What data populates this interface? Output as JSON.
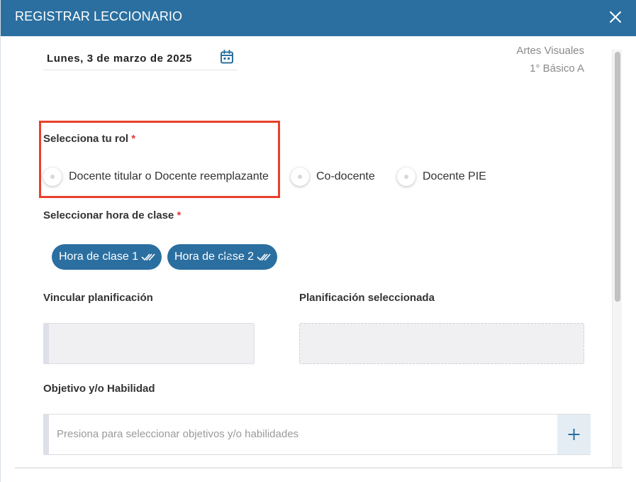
{
  "header": {
    "title": "REGISTRAR LECCIONARIO",
    "close_icon": "close-icon"
  },
  "date": {
    "value": "Lunes, 3 de marzo de 2025",
    "icon": "calendar-icon"
  },
  "subject": {
    "name": "Artes Visuales",
    "grade": "1° Básico A"
  },
  "rol": {
    "label": "Selecciona tu rol",
    "required_mark": "*",
    "options": [
      {
        "label": "Docente titular o Docente reemplazante",
        "selected": false
      },
      {
        "label": "Co-docente",
        "selected": false
      },
      {
        "label": "Docente PIE",
        "selected": false
      }
    ]
  },
  "hora": {
    "label": "Seleccionar hora de clase",
    "required_mark": "*",
    "chips": [
      {
        "label": "Hora de clase 1",
        "icon": "double-check-icon"
      },
      {
        "label": "Hora de clase 2",
        "icon": "double-check-icon"
      }
    ]
  },
  "planificacion": {
    "vincular_label": "Vincular planificación",
    "info_icon": "info-icon",
    "seleccionada_label": "Planificación seleccionada"
  },
  "objetivo": {
    "label": "Objetivo y/o Habilidad",
    "placeholder": "Presiona para seleccionar objetivos y/o habilidades",
    "add_icon": "plus-icon"
  },
  "colors": {
    "primary": "#2b6fa0",
    "highlight": "#e8402a",
    "required": "#e53935",
    "muted_text": "#8a8a8a"
  }
}
